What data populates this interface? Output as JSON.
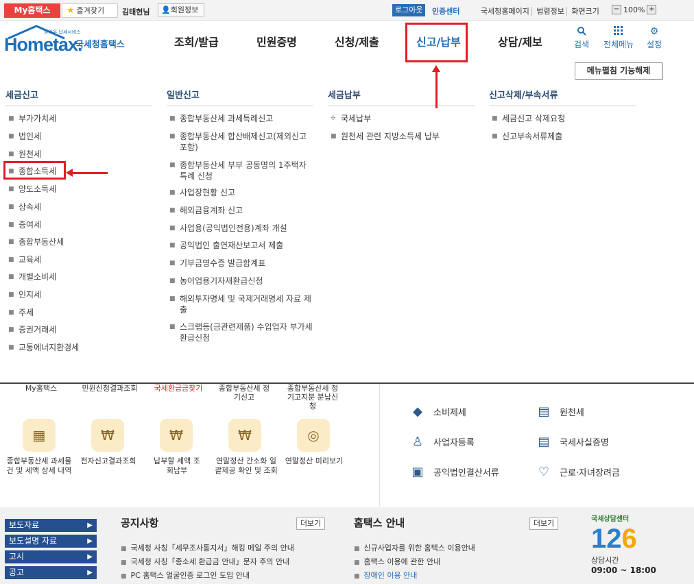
{
  "topbar": {
    "my_hometax": "My홈택스",
    "favorites": "즐겨찾기",
    "user_name": "김태현님",
    "member_info": "회원정보",
    "logout": "로그아웃",
    "cert_center": "인증센터",
    "links": [
      "국세청홈페이지",
      "법령정보",
      "화면크기"
    ],
    "zoom_minus": "−",
    "zoom_level": "100%",
    "zoom_plus": "+"
  },
  "header": {
    "logo_text": "Hometax.",
    "logo_tiny": "믿어온 납세서비스",
    "logo_sub": "국세청홈택스",
    "nav": [
      "조회/발급",
      "민원증명",
      "신청/제출",
      "신고/납부",
      "상담/제보"
    ],
    "icons": [
      {
        "label": "검색",
        "icon": "search-icon"
      },
      {
        "label": "전체메뉴",
        "icon": "grid-icon"
      },
      {
        "label": "설정",
        "icon": "gear-icon"
      }
    ],
    "menu_fold": "메뉴펼침 기능해제"
  },
  "megamenu": {
    "col1": {
      "title": "세금신고",
      "items": [
        "부가가치세",
        "법인세",
        "원천세",
        "종합소득세",
        "양도소득세",
        "상속세",
        "증여세",
        "종합부동산세",
        "교육세",
        "개별소비세",
        "인지세",
        "주세",
        "증권거래세",
        "교통에너지환경세"
      ]
    },
    "col2": {
      "title": "일반신고",
      "items": [
        "종합부동산세 과세특례신고",
        "종합부동산세 합산배제신고(제외신고포함)",
        "종합부동산세 부부 공동명의 1주택자 특례 신청",
        "사업장현황 신고",
        "해외금융계좌 신고",
        "사업용(공익법인전용)계좌 개설",
        "공익법인 출연재산보고서 제출",
        "기부금영수증 발급합계표",
        "농어업용기자재환급신청",
        "해외투자명세 및 국제거래명세 자료 제출",
        "스크랩등(금관련제품) 수입업자 부가세 환급신청"
      ]
    },
    "col3": {
      "title": "세금납부",
      "items": [
        "국세납부",
        "원천세 관련 지방소득세 납부"
      ]
    },
    "col4": {
      "title": "신고삭제/부속서류",
      "items": [
        "세금신고 삭제요청",
        "신고부속서류제출"
      ]
    }
  },
  "background": {
    "cut_labels": [
      "My홈택스",
      "민원신청결과조회",
      "국세환급금찾기",
      "종합부동산세 정기신고",
      "종합부동산세 정기고지분 분납신청"
    ],
    "quick": [
      {
        "label": "종합부동산세 과세물건 및 세액 상세 내역",
        "icon": "calendar-icon"
      },
      {
        "label": "전자신고결과조회",
        "icon": "search-doc-icon"
      },
      {
        "label": "납부할 세액 조회납부",
        "icon": "money-bag-icon"
      },
      {
        "label": "연말정산 간소화 일괄제공 확인 및 조회",
        "icon": "money-bag-icon"
      },
      {
        "label": "연말정산 미리보기",
        "icon": "coin-icon"
      }
    ],
    "right_items": [
      {
        "label": "소비제세",
        "icon": "diamond-icon"
      },
      {
        "label": "원천세",
        "icon": "salary-doc-icon"
      },
      {
        "label": "사업자등록",
        "icon": "person-icon"
      },
      {
        "label": "국세사실증명",
        "icon": "document-icon"
      },
      {
        "label": "공익법인결산서류",
        "icon": "clipboard-icon"
      },
      {
        "label": "근로·자녀장려금",
        "icon": "heart-icon"
      }
    ]
  },
  "footer": {
    "buttons": [
      "보도자료",
      "보도설명 자료",
      "고시",
      "공고"
    ],
    "notice_title": "공지사항",
    "notice_more": "더보기",
    "notices": [
      "국세청 사칭「세무조사통지서」해킹 메일 주의 안내",
      "국세청 사칭「종소세 환급금 안내」문자 주의 안내",
      "PC 홈택스 얼굴인증 로그인 도입 안내"
    ],
    "guide_title": "홈택스 안내",
    "guide_more": "더보기",
    "guides": [
      "신규사업자를 위한 홈택스 이용안내",
      "홈택스 이용에 관한 안내",
      "장애인 이용 안내"
    ],
    "center_top": "국세상담센터",
    "center_num_a": "12",
    "center_num_b": "6",
    "center_hours_label": "상담시간",
    "center_hours": "09:00 ~ 18:00"
  },
  "colors": {
    "accent_blue": "#1e6fba",
    "highlight_red": "#e01e25",
    "footer_button": "#254f8f"
  }
}
